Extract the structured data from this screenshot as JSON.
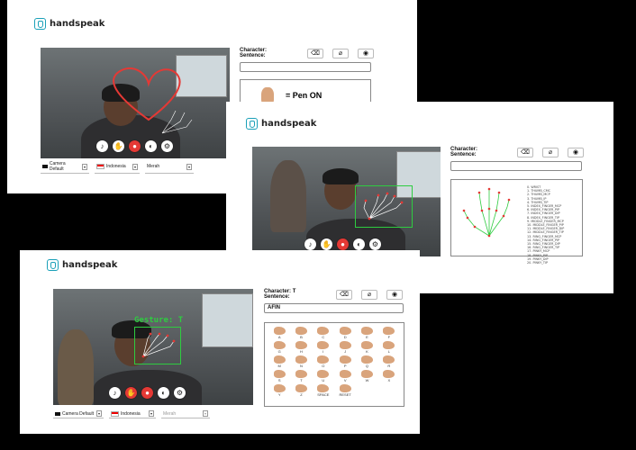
{
  "brand": {
    "name": "handspeak"
  },
  "screens": [
    {
      "controls": {
        "camera": "Camera Default",
        "language": "Indonesia",
        "color": "Merah"
      },
      "panel": {
        "character_label": "Character:",
        "sentence_label": "Sentence:",
        "character_value": "",
        "sentence_value": "",
        "pen_label": "= Pen ON"
      }
    },
    {
      "panel": {
        "character_label": "Character:",
        "sentence_label": "Sentence:",
        "character_value": "",
        "sentence_value": ""
      },
      "landmarks": [
        "0. WRIST",
        "1. THUMB_CMC",
        "2. THUMB_MCP",
        "3. THUMB_IP",
        "4. THUMB_TIP",
        "5. INDEX_FINGER_MCP",
        "6. INDEX_FINGER_PIP",
        "7. INDEX_FINGER_DIP",
        "8. INDEX_FINGER_TIP",
        "9. MIDDLE_FINGER_MCP",
        "10. MIDDLE_FINGER_PIP",
        "11. MIDDLE_FINGER_DIP",
        "12. MIDDLE_FINGER_TIP",
        "13. RING_FINGER_MCP",
        "14. RING_FINGER_PIP",
        "15. RING_FINGER_DIP",
        "16. RING_FINGER_TIP",
        "17. PINKY_MCP",
        "18. PINKY_PIP",
        "19. PINKY_DIP",
        "20. PINKY_TIP"
      ]
    },
    {
      "controls": {
        "camera": "Camera Default",
        "language": "Indonesia",
        "color": "Merah"
      },
      "panel": {
        "character_label": "Character:",
        "character_value": "T",
        "sentence_label": "Sentence:",
        "sentence_value": "AFIN"
      },
      "gesture": "Gesture: T",
      "alphabet": [
        "A",
        "B",
        "C",
        "D",
        "E",
        "F",
        "G",
        "H",
        "I",
        "J",
        "K",
        "L",
        "M",
        "N",
        "O",
        "P",
        "Q",
        "R",
        "S",
        "T",
        "U",
        "V",
        "W",
        "X",
        "Y",
        "Z",
        "SPACE",
        "RESET"
      ]
    }
  ]
}
